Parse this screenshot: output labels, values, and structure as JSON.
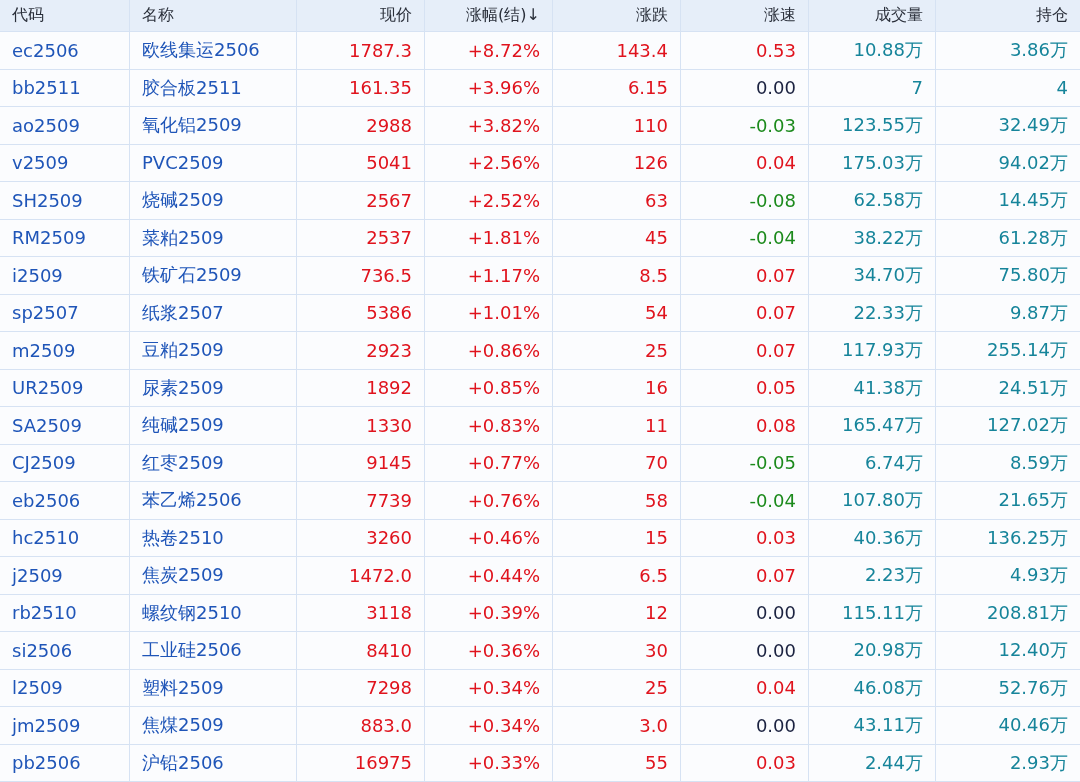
{
  "table": {
    "columns": [
      "代码",
      "名称",
      "现价",
      "涨幅(结)↓",
      "涨跌",
      "涨速",
      "成交量",
      "持仓"
    ],
    "rows": [
      {
        "code": "ec2506",
        "name": "欧线集运2506",
        "price": "1787.3",
        "change_pct": "+8.72%",
        "change": "143.4",
        "speed": {
          "text": "0.53",
          "color": "#e0131d"
        },
        "volume": "10.88万",
        "open_interest": "3.86万"
      },
      {
        "code": "bb2511",
        "name": "胶合板2511",
        "price": "161.35",
        "change_pct": "+3.96%",
        "change": "6.15",
        "speed": {
          "text": "0.00",
          "color": "#1b2240"
        },
        "volume": "7",
        "open_interest": "4"
      },
      {
        "code": "ao2509",
        "name": "氧化铝2509",
        "price": "2988",
        "change_pct": "+3.82%",
        "change": "110",
        "speed": {
          "text": "-0.03",
          "color": "#1c8a1c"
        },
        "volume": "123.55万",
        "open_interest": "32.49万"
      },
      {
        "code": "v2509",
        "name": "PVC2509",
        "price": "5041",
        "change_pct": "+2.56%",
        "change": "126",
        "speed": {
          "text": "0.04",
          "color": "#e0131d"
        },
        "volume": "175.03万",
        "open_interest": "94.02万"
      },
      {
        "code": "SH2509",
        "name": "烧碱2509",
        "price": "2567",
        "change_pct": "+2.52%",
        "change": "63",
        "speed": {
          "text": "-0.08",
          "color": "#1c8a1c"
        },
        "volume": "62.58万",
        "open_interest": "14.45万"
      },
      {
        "code": "RM2509",
        "name": "菜粕2509",
        "price": "2537",
        "change_pct": "+1.81%",
        "change": "45",
        "speed": {
          "text": "-0.04",
          "color": "#1c8a1c"
        },
        "volume": "38.22万",
        "open_interest": "61.28万"
      },
      {
        "code": "i2509",
        "name": "铁矿石2509",
        "price": "736.5",
        "change_pct": "+1.17%",
        "change": "8.5",
        "speed": {
          "text": "0.07",
          "color": "#e0131d"
        },
        "volume": "34.70万",
        "open_interest": "75.80万"
      },
      {
        "code": "sp2507",
        "name": "纸浆2507",
        "price": "5386",
        "change_pct": "+1.01%",
        "change": "54",
        "speed": {
          "text": "0.07",
          "color": "#e0131d"
        },
        "volume": "22.33万",
        "open_interest": "9.87万"
      },
      {
        "code": "m2509",
        "name": "豆粕2509",
        "price": "2923",
        "change_pct": "+0.86%",
        "change": "25",
        "speed": {
          "text": "0.07",
          "color": "#e0131d"
        },
        "volume": "117.93万",
        "open_interest": "255.14万"
      },
      {
        "code": "UR2509",
        "name": "尿素2509",
        "price": "1892",
        "change_pct": "+0.85%",
        "change": "16",
        "speed": {
          "text": "0.05",
          "color": "#e0131d"
        },
        "volume": "41.38万",
        "open_interest": "24.51万"
      },
      {
        "code": "SA2509",
        "name": "纯碱2509",
        "price": "1330",
        "change_pct": "+0.83%",
        "change": "11",
        "speed": {
          "text": "0.08",
          "color": "#e0131d"
        },
        "volume": "165.47万",
        "open_interest": "127.02万"
      },
      {
        "code": "CJ2509",
        "name": "红枣2509",
        "price": "9145",
        "change_pct": "+0.77%",
        "change": "70",
        "speed": {
          "text": "-0.05",
          "color": "#1c8a1c"
        },
        "volume": "6.74万",
        "open_interest": "8.59万"
      },
      {
        "code": "eb2506",
        "name": "苯乙烯2506",
        "price": "7739",
        "change_pct": "+0.76%",
        "change": "58",
        "speed": {
          "text": "-0.04",
          "color": "#1c8a1c"
        },
        "volume": "107.80万",
        "open_interest": "21.65万"
      },
      {
        "code": "hc2510",
        "name": "热卷2510",
        "price": "3260",
        "change_pct": "+0.46%",
        "change": "15",
        "speed": {
          "text": "0.03",
          "color": "#e0131d"
        },
        "volume": "40.36万",
        "open_interest": "136.25万"
      },
      {
        "code": "j2509",
        "name": "焦炭2509",
        "price": "1472.0",
        "change_pct": "+0.44%",
        "change": "6.5",
        "speed": {
          "text": "0.07",
          "color": "#e0131d"
        },
        "volume": "2.23万",
        "open_interest": "4.93万"
      },
      {
        "code": "rb2510",
        "name": "螺纹钢2510",
        "price": "3118",
        "change_pct": "+0.39%",
        "change": "12",
        "speed": {
          "text": "0.00",
          "color": "#1b2240"
        },
        "volume": "115.11万",
        "open_interest": "208.81万"
      },
      {
        "code": "si2506",
        "name": "工业硅2506",
        "price": "8410",
        "change_pct": "+0.36%",
        "change": "30",
        "speed": {
          "text": "0.00",
          "color": "#1b2240"
        },
        "volume": "20.98万",
        "open_interest": "12.40万"
      },
      {
        "code": "l2509",
        "name": "塑料2509",
        "price": "7298",
        "change_pct": "+0.34%",
        "change": "25",
        "speed": {
          "text": "0.04",
          "color": "#e0131d"
        },
        "volume": "46.08万",
        "open_interest": "52.76万"
      },
      {
        "code": "jm2509",
        "name": "焦煤2509",
        "price": "883.0",
        "change_pct": "+0.34%",
        "change": "3.0",
        "speed": {
          "text": "0.00",
          "color": "#1b2240"
        },
        "volume": "43.11万",
        "open_interest": "40.46万"
      },
      {
        "code": "pb2506",
        "name": "沪铅2506",
        "price": "16975",
        "change_pct": "+0.33%",
        "change": "55",
        "speed": {
          "text": "0.03",
          "color": "#e0131d"
        },
        "volume": "2.44万",
        "open_interest": "2.93万"
      }
    ]
  }
}
